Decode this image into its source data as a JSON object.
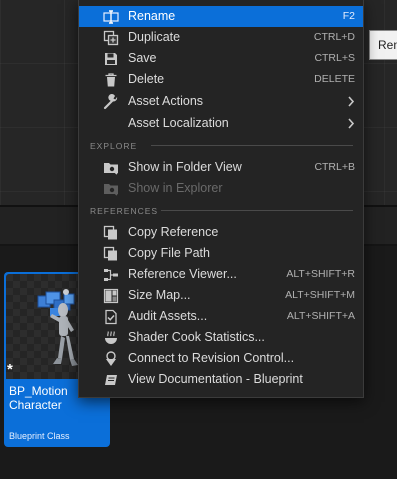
{
  "tooltip": {
    "text": "Rename"
  },
  "asset": {
    "name": "BP_Motion Character",
    "type": "Blueprint Class",
    "modified_marker": "*"
  },
  "menu": {
    "top_items": [
      {
        "label": "Rename",
        "shortcut": "F2",
        "icon": "rename-icon",
        "highlighted": true
      },
      {
        "label": "Duplicate",
        "shortcut": "CTRL+D",
        "icon": "duplicate-icon"
      },
      {
        "label": "Save",
        "shortcut": "CTRL+S",
        "icon": "save-icon"
      },
      {
        "label": "Delete",
        "shortcut": "DELETE",
        "icon": "trash-icon"
      },
      {
        "label": "Asset Actions",
        "icon": "wrench-icon",
        "submenu": true
      },
      {
        "label": "Asset Localization",
        "icon": "globe-icon",
        "submenu": true
      }
    ],
    "explore": {
      "title": "EXPLORE",
      "items": [
        {
          "label": "Show in Folder View",
          "shortcut": "CTRL+B",
          "icon": "folder-view-icon"
        },
        {
          "label": "Show in Explorer",
          "icon": "folder-explorer-icon",
          "disabled": true
        }
      ]
    },
    "references": {
      "title": "REFERENCES",
      "items": [
        {
          "label": "Copy Reference",
          "icon": "copy-icon"
        },
        {
          "label": "Copy File Path",
          "icon": "copy-icon"
        },
        {
          "label": "Reference Viewer...",
          "shortcut": "ALT+SHIFT+R",
          "icon": "reference-viewer-icon"
        },
        {
          "label": "Size Map...",
          "shortcut": "ALT+SHIFT+M",
          "icon": "size-map-icon"
        },
        {
          "label": "Audit Assets...",
          "shortcut": "ALT+SHIFT+A",
          "icon": "audit-icon"
        },
        {
          "label": "Shader Cook Statistics...",
          "icon": "shader-icon"
        },
        {
          "label": "Connect to Revision Control...",
          "icon": "revision-control-icon"
        },
        {
          "label": "View Documentation - Blueprint",
          "icon": "documentation-icon"
        }
      ]
    }
  },
  "colors": {
    "accent": "#0B6FD9",
    "menu_bg": "#242424"
  }
}
